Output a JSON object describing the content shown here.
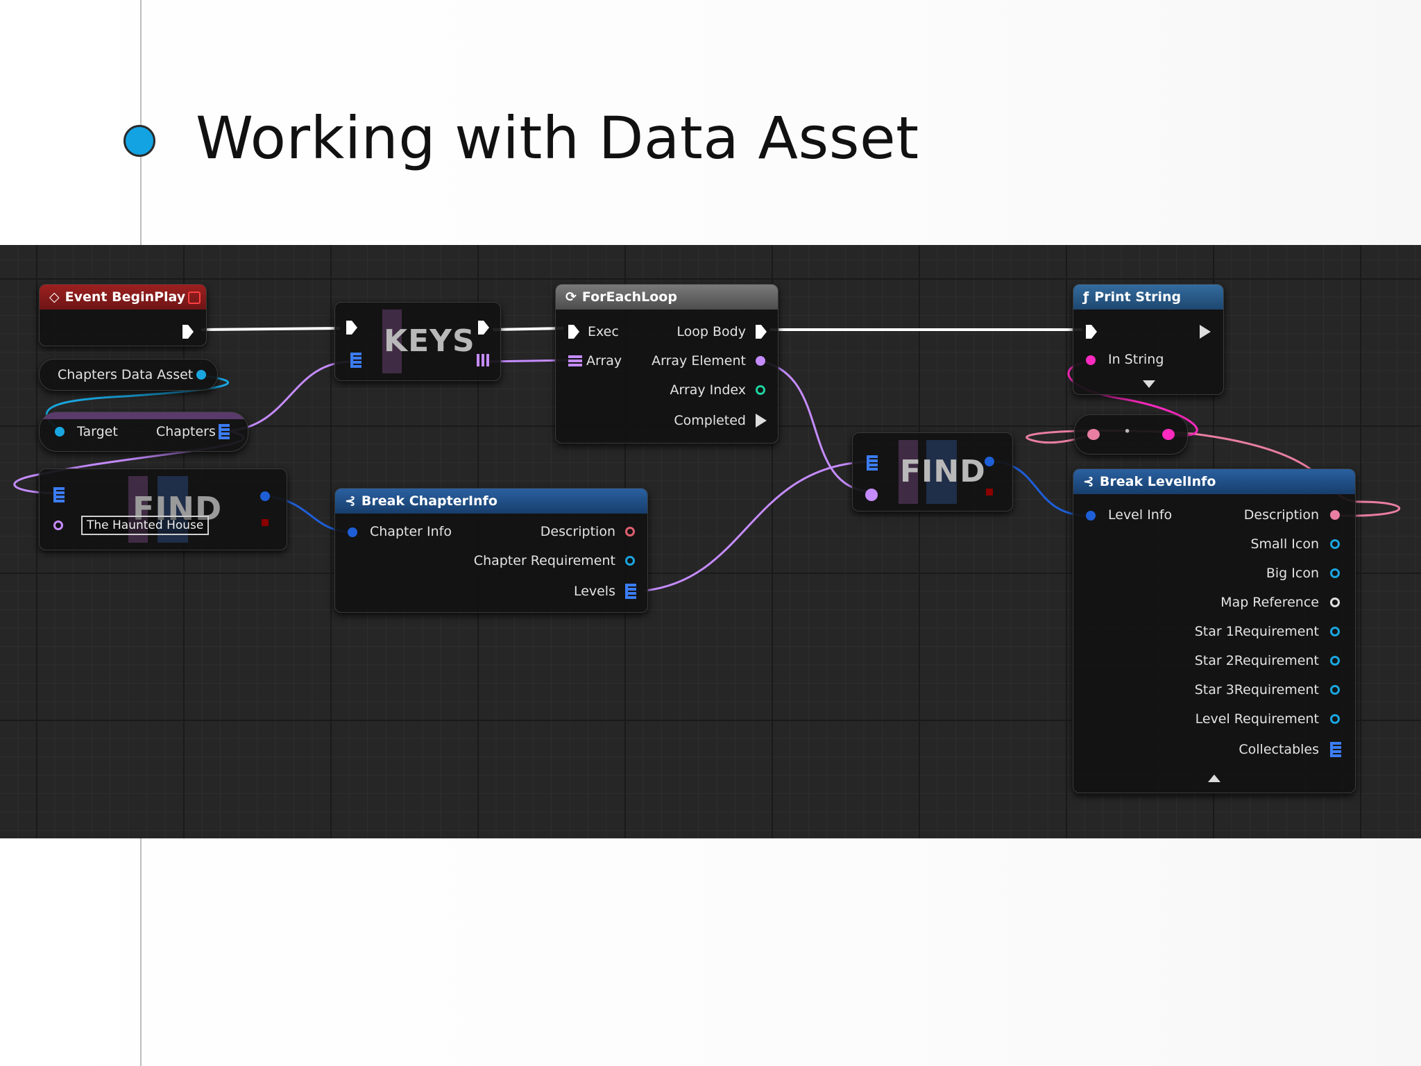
{
  "slide": {
    "title": "Working with Data Asset",
    "bullet_color": "#13a3e3"
  },
  "blueprint": {
    "nodes": {
      "event_begin_play": {
        "title": "Event BeginPlay",
        "icon": "event-diamond-icon",
        "header_color": "#8e1b1b"
      },
      "chapters_data_asset": {
        "label": "Chapters Data Asset"
      },
      "get_chapters": {
        "target_label": "Target",
        "output_label": "Chapters"
      },
      "find_1": {
        "title": "FIND",
        "key_value": "The Haunted House"
      },
      "keys": {
        "title": "KEYS"
      },
      "for_each_loop": {
        "title": "ForEachLoop",
        "icon": "loop-icon",
        "header_color": "#6b6b6b",
        "exec": "Exec",
        "array": "Array",
        "loop_body": "Loop Body",
        "array_element": "Array Element",
        "array_index": "Array Index",
        "completed": "Completed"
      },
      "break_chapter_info": {
        "title": "Break ChapterInfo",
        "icon": "break-struct-icon",
        "header_color": "#1f4f8a",
        "input": "Chapter Info",
        "outputs": [
          "Description",
          "Chapter Requirement",
          "Levels"
        ]
      },
      "find_2": {
        "title": "FIND"
      },
      "print_string": {
        "title": "Print String",
        "icon": "function-icon",
        "header_color": "#2b5a88",
        "input": "In String"
      },
      "append": {
        "separator": "•"
      },
      "break_level_info": {
        "title": "Break LevelInfo",
        "icon": "break-struct-icon",
        "header_color": "#1f4f8a",
        "input": "Level Info",
        "outputs": [
          "Description",
          "Small Icon",
          "Big Icon",
          "Map Reference",
          "Star 1Requirement",
          "Star 2Requirement",
          "Star 3Requirement",
          "Level Requirement",
          "Collectables"
        ]
      }
    },
    "colors": {
      "graph_bg": "#262626",
      "exec_wire": "#ffffff",
      "object_pin": "#00a8f0",
      "struct_pin": "#1e5fd8",
      "string_pin": "#ff2ac0",
      "name_pin": "#c58cff",
      "int_pin": "#1fd3a0",
      "text_pin": "#e87ea1"
    }
  }
}
